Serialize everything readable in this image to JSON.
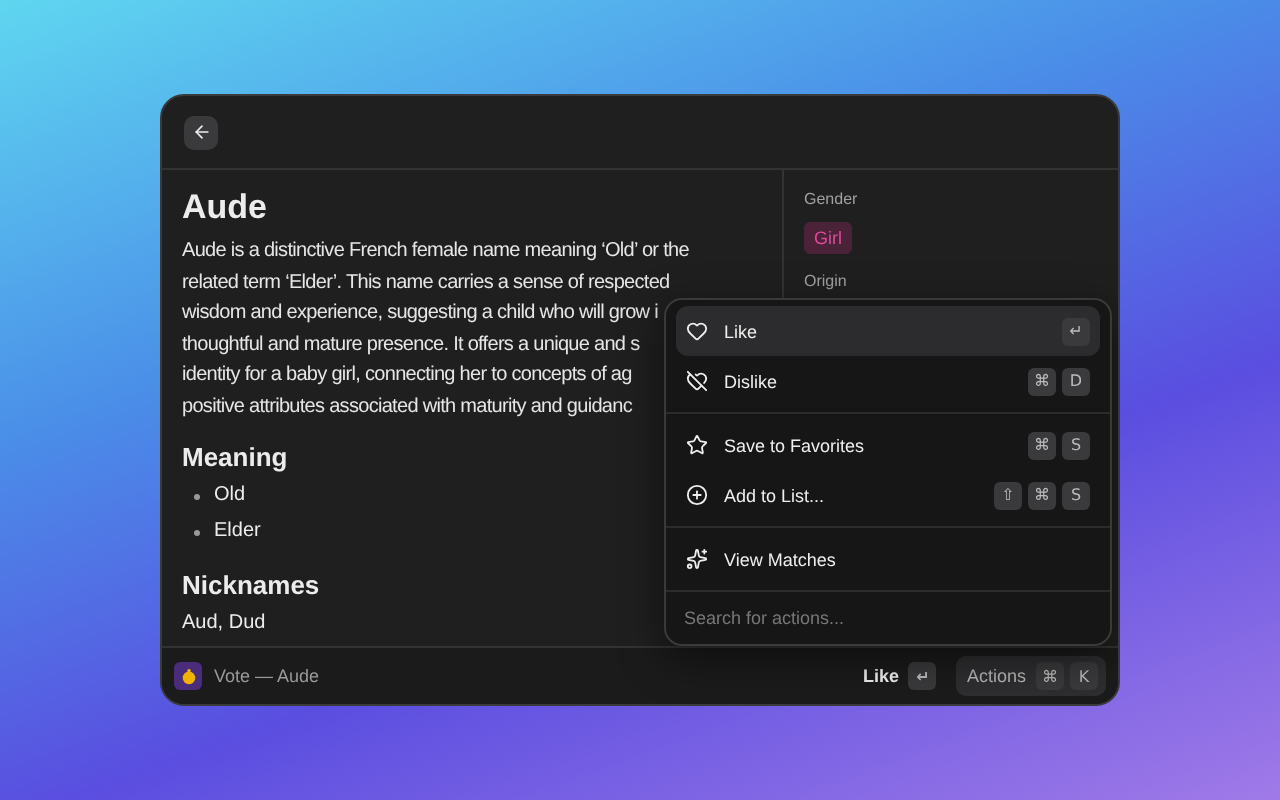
{
  "article": {
    "title": "Aude",
    "lines": [
      "Aude is a distinctive French female name meaning ‘Old’ or the",
      "related term ‘Elder’. This name carries a sense of respected",
      "wisdom and experience, suggesting a child who will grow i",
      "thoughtful and mature presence. It offers a unique and s",
      "identity for a baby girl, connecting her to concepts of ag",
      "positive attributes associated with maturity and guidanc"
    ],
    "sections": [
      {
        "kind": "list",
        "heading": "Meaning",
        "items": [
          "Old",
          "Elder"
        ]
      },
      {
        "kind": "text",
        "heading": "Nicknames",
        "text": "Aud, Dud"
      }
    ]
  },
  "details": [
    {
      "label": "Gender",
      "tag": "Girl"
    },
    {
      "label": "Origin"
    }
  ],
  "menu": {
    "groups": [
      [
        {
          "label": "Like",
          "keys": [
            "↵"
          ],
          "selected": true
        },
        {
          "label": "Dislike",
          "keys": [
            "⌘",
            "D"
          ],
          "selected": false
        }
      ],
      [
        {
          "label": "Save to Favorites",
          "keys": [
            "⌘",
            "S"
          ],
          "selected": false
        },
        {
          "label": "Add to List...",
          "keys": [
            "⇧",
            "⌘",
            "S"
          ],
          "selected": false
        }
      ],
      [
        {
          "label": "View Matches",
          "selected": false
        }
      ]
    ],
    "search": {
      "placeholder": "Search for actions..."
    }
  },
  "footer": {
    "title": "Vote — Aude",
    "primary": {
      "label": "Like",
      "keys": [
        "↵"
      ]
    },
    "actions": {
      "label": "Actions",
      "keys": [
        "⌘",
        "K"
      ]
    }
  }
}
